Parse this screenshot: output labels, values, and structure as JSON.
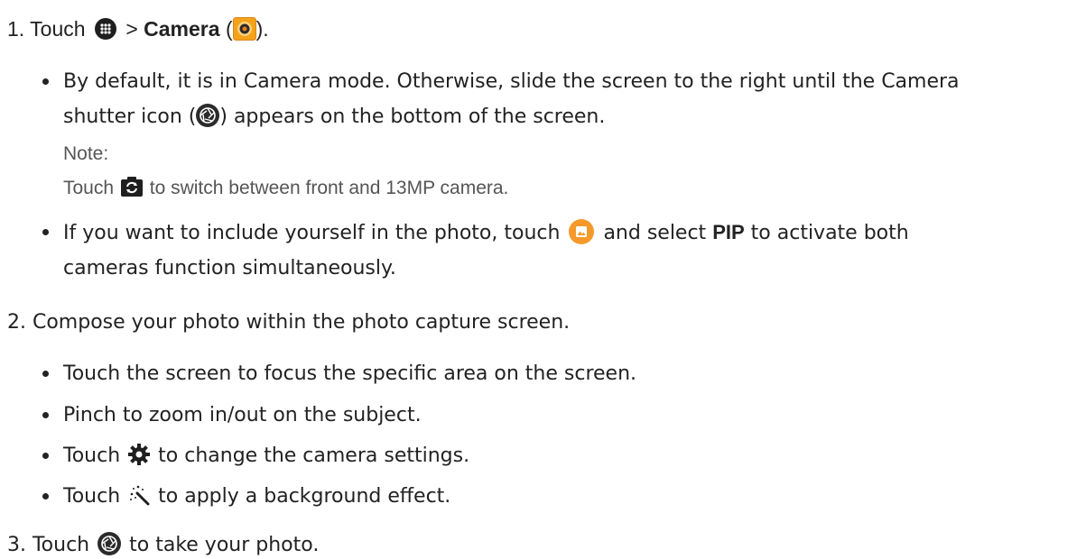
{
  "step1": {
    "num": "1.",
    "pre": "Touch",
    "sep": ">",
    "camera_label": "Camera",
    "paren_open": "(",
    "paren_close": ")."
  },
  "bullet1": {
    "line1": "By default, it is in Camera mode. Otherwise, slide the screen to the right until the Camera",
    "line2_pre": "shutter icon (",
    "line2_post": ") appears on the bottom of the screen."
  },
  "note": {
    "title": "Note:",
    "pre": "Touch",
    "post": "to switch between front and 13MP camera."
  },
  "bullet2": {
    "line1_pre": "If you want to include yourself in the photo, touch",
    "line1_mid": "and select",
    "pip": "PIP",
    "line1_post": "to activate both",
    "line2": "cameras function simultaneously."
  },
  "step2": {
    "text": "2. Compose your photo within the photo capture screen."
  },
  "bullets2": [
    "Touch the screen to focus the specific area on the screen.",
    "Pinch to zoom in/out  on the subject."
  ],
  "bullet_settings": {
    "pre": "Touch",
    "post": "to change the camera settings."
  },
  "bullet_effect": {
    "pre": "Touch",
    "post": "to apply a background effect."
  },
  "step3": {
    "pre": "3. Touch",
    "post": "to take your photo."
  },
  "colors": {
    "camera_orange": "#f5a21b",
    "gallery_orange": "#f59a2a",
    "icon_dark": "#2b2b2b"
  }
}
